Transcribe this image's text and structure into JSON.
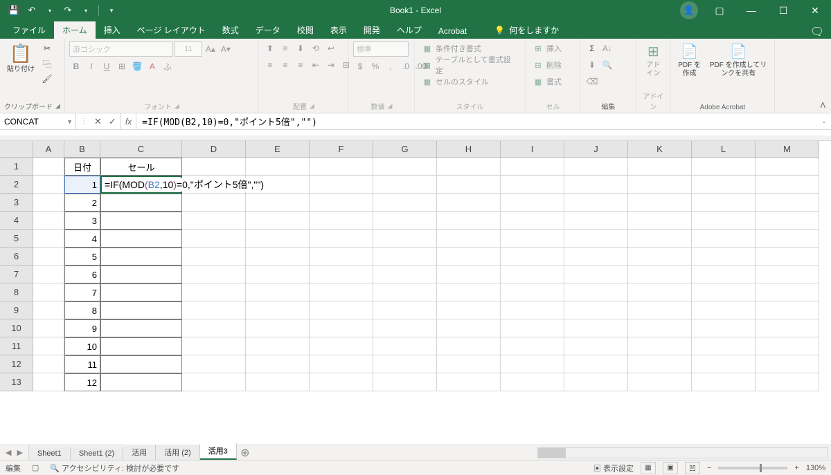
{
  "title": "Book1 - Excel",
  "tabs": {
    "file": "ファイル",
    "home": "ホーム",
    "insert": "挿入",
    "pagelayout": "ページ レイアウト",
    "formulas": "数式",
    "data": "データ",
    "review": "校閲",
    "view": "表示",
    "developer": "開発",
    "help": "ヘルプ",
    "acrobat": "Acrobat"
  },
  "tell_me": "何をしますか",
  "ribbon": {
    "clipboard": {
      "label": "クリップボード",
      "paste": "貼り付け"
    },
    "font": {
      "label": "フォント",
      "name": "游ゴシック",
      "size": "11"
    },
    "alignment": {
      "label": "配置"
    },
    "number": {
      "label": "数値",
      "format": "標準"
    },
    "styles": {
      "label": "スタイル",
      "cond": "条件付き書式",
      "table": "テーブルとして書式設定",
      "cell": "セルのスタイル"
    },
    "cells": {
      "label": "セル",
      "insert": "挿入",
      "delete": "削除",
      "format": "書式"
    },
    "editing": {
      "label": "編集"
    },
    "addin": {
      "label": "アドイン",
      "btn": "アドイン"
    },
    "acrobat": {
      "label": "Adobe Acrobat",
      "create": "PDF を作成",
      "share": "PDF を作成してリンクを共有"
    }
  },
  "formula_bar": {
    "name_box": "CONCAT",
    "formula": "=IF(MOD(B2,10)=0,\"ポイント5倍\",\"\")"
  },
  "columns": [
    "A",
    "B",
    "C",
    "D",
    "E",
    "F",
    "G",
    "H",
    "I",
    "J",
    "K",
    "L",
    "M"
  ],
  "rows": [
    "1",
    "2",
    "3",
    "4",
    "5",
    "6",
    "7",
    "8",
    "9",
    "10",
    "11",
    "12",
    "13"
  ],
  "headers": {
    "b1": "日付",
    "c1": "セール"
  },
  "bvals": [
    "1",
    "2",
    "3",
    "4",
    "5",
    "6",
    "7",
    "8",
    "9",
    "10",
    "11",
    "12"
  ],
  "edit_formula": {
    "prefix": "=IF",
    "p1o": "(",
    "fn2": "MOD",
    "p2o": "(",
    "ref": "B2",
    "mid": ",10",
    "p2c": ")",
    "rest": "=0,\"ポイント5倍\",\"\"",
    "p1c": ")"
  },
  "sheets": [
    "Sheet1",
    "Sheet1 (2)",
    "活用",
    "活用 (2)",
    "活用3"
  ],
  "status": {
    "mode": "編集",
    "acc": "アクセシビリティ: 検討が必要です",
    "display": "表示設定",
    "zoom": "130%"
  }
}
